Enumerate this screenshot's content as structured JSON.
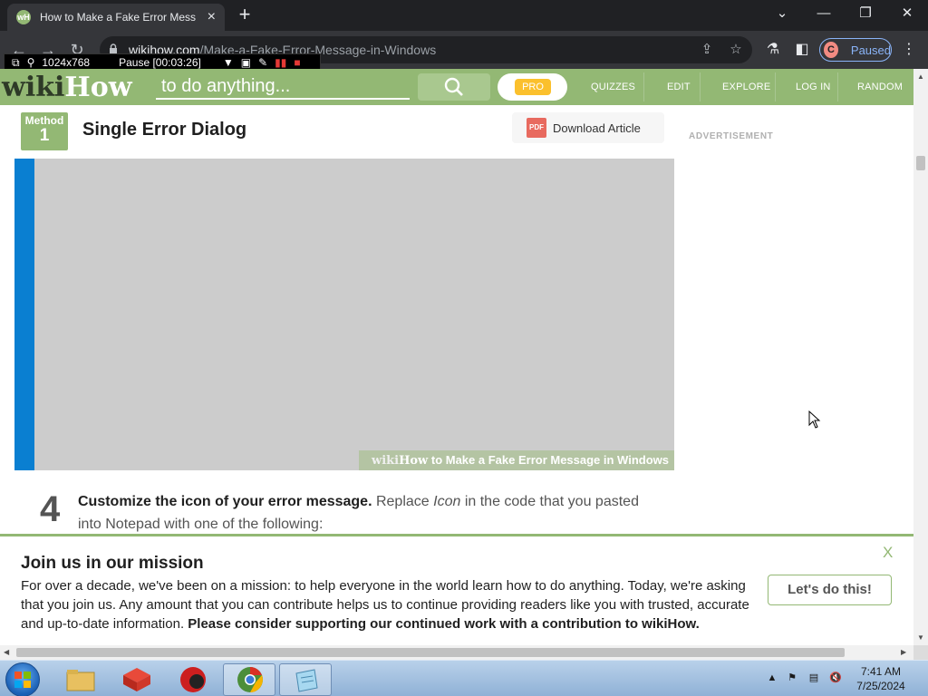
{
  "browser": {
    "tab_title": "How to Make a Fake Error Message in Windows",
    "favicon_letter": "wH",
    "url_host": "wikihow.com",
    "url_path": "/Make-a-Fake-Error-Message-in-Windows",
    "profile_initial": "C",
    "profile_status": "Paused"
  },
  "recorder": {
    "resolution": "1024x768",
    "status": "Pause [00:03:26]"
  },
  "header": {
    "logo_wiki": "wiki",
    "logo_how": "How",
    "search_placeholder": "to do anything...",
    "pro_label": "PRO",
    "nav": [
      "QUIZZES",
      "EDIT",
      "EXPLORE",
      "LOG IN",
      "RANDOM"
    ]
  },
  "article": {
    "method_label": "Method",
    "method_number": "1",
    "method_title": "Single Error Dialog",
    "download_icon_text": "PDF",
    "download_label": "Download Article",
    "ad_label": "ADVERTISEMENT",
    "image_caption_wiki": "wiki",
    "image_caption_how": "How",
    "image_caption_text": " to Make a Fake Error Message in Windows",
    "step_number": "4",
    "step_bold": "Customize the icon of your error message.",
    "step_text_1": " Replace ",
    "step_italic": "Icon",
    "step_text_2": " in the code that you pasted into Notepad with one of the following:"
  },
  "mission": {
    "title": "Join us in our mission",
    "body": "For over a decade, we've been on a mission: to help everyone in the world learn how to do anything. Today, we're asking that you join us. Any amount that you can contribute helps us to continue providing readers like you with trusted, accurate and up-to-date information.",
    "body_bold": " Please consider supporting our continued work with a contribution to wikiHow.",
    "button": "Let's do this!",
    "close": "X"
  },
  "taskbar": {
    "time": "7:41 AM",
    "date": "7/25/2024",
    "apps": [
      "file-explorer-icon",
      "app-red-cube-icon",
      "app-red-ball-icon",
      "chrome-icon",
      "notepad-icon"
    ]
  },
  "colors": {
    "wikihow_green": "#93b874",
    "accent_blue": "#0a7fd1",
    "chrome_dark": "#202124"
  }
}
